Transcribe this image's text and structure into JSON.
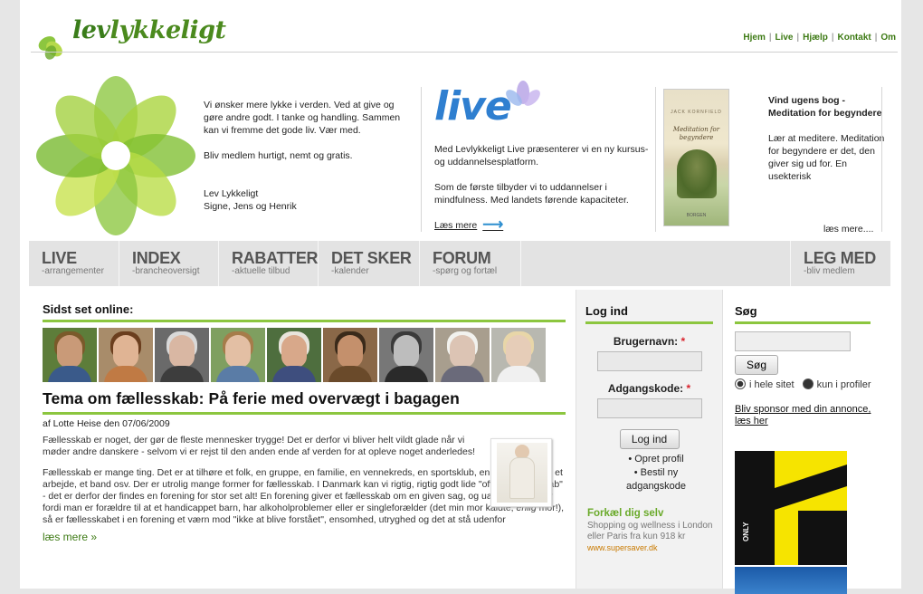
{
  "logo": {
    "lev": "lev",
    "rest": "lykkeligt"
  },
  "topnav": [
    "Hjem",
    "Live",
    "Hjælp",
    "Kontakt",
    "Om"
  ],
  "intro": {
    "p1": "Vi ønsker mere lykke i verden. Ved at give og gøre andre godt. I tanke og handling. Sammen kan vi fremme det gode liv. Vær med.",
    "p2": "Bliv medlem hurtigt, nemt og gratis.",
    "sig1": "Lev Lykkeligt",
    "sig2": "Signe, Jens og Henrik"
  },
  "live": {
    "logo": "live",
    "p1": "Med Levlykkeligt Live præsenterer vi en ny kursus- og uddannelsesplatform.",
    "p2": "Som de første tilbyder vi to uddannelser i mindfulness. Med landets førende kapaciteter.",
    "more": "Læs mere"
  },
  "book": {
    "cover_author": "JACK KORNFIELD",
    "cover_title": "Meditation for begyndere",
    "cover_pub": "BORGEN",
    "title": "Vind ugens bog - Meditation for begyndere",
    "text": "Lær at meditere. Meditation for begyndere er det, den giver sig ud for. En usekterisk",
    "more": "læs mere...."
  },
  "mainnav": [
    {
      "title": "LIVE",
      "sub": "-arrangementer"
    },
    {
      "title": "INDEX",
      "sub": "-brancheoversigt"
    },
    {
      "title": "RABATTER",
      "sub": "-aktuelle tilbud"
    },
    {
      "title": "DET SKER",
      "sub": "-kalender"
    },
    {
      "title": "FORUM",
      "sub": "-spørg og fortæl"
    },
    {
      "title": "LEG MED",
      "sub": "-bliv medlem"
    }
  ],
  "online": {
    "heading": "Sidst set online:",
    "faces": [
      {
        "skin": "#c99a78",
        "hair": "#7a5a2a",
        "bg": "#5d7d3a",
        "shirt": "#3a5a8a"
      },
      {
        "skin": "#e0b494",
        "hair": "#6b3e1e",
        "bg": "#a88c6a",
        "shirt": "#c07a44"
      },
      {
        "skin": "#d9b7a3",
        "hair": "#d9d9d9",
        "bg": "#6a6a6a",
        "shirt": "#3d3d3d"
      },
      {
        "skin": "#e3bfa4",
        "hair": "#a67c4a",
        "bg": "#7f9f60",
        "shirt": "#5a7ca6"
      },
      {
        "skin": "#d8a88a",
        "hair": "#e8e4dc",
        "bg": "#4e6e3e",
        "shirt": "#3e4e7e"
      },
      {
        "skin": "#c4906c",
        "hair": "#3a2a1a",
        "bg": "#8a6848",
        "shirt": "#6a4a2a"
      },
      {
        "skin": "#bdbdbd",
        "hair": "#3a3a3a",
        "bg": "#777777",
        "shirt": "#2a2a2a"
      },
      {
        "skin": "#dcc4b4",
        "hair": "#f2f2ee",
        "bg": "#a89e8e",
        "shirt": "#6a6a7a"
      },
      {
        "skin": "#e6cdb8",
        "hair": "#e8d6a8",
        "bg": "#b8b8b0",
        "shirt": "#f0f0f0"
      }
    ]
  },
  "article": {
    "title": "Tema om fællesskab: På ferie med overvægt i bagagen",
    "byline": "af Lotte Heise den 07/06/2009",
    "p1": "Fællesskab er noget, der gør de fleste mennesker trygge! Det er derfor vi bliver helt vildt glade når vi møder andre danskere - selvom vi er rejst til den anden ende af verden for at opleve noget anderledes!",
    "p2a": "Fællesskab er mange ting. Det er at tilhøre et folk, en gruppe, en familie, en vennekreds, en sportsklub, en mødregruppe, et arbejde, et band osv. Der er utrolig mange former for fællesskab. I Danmark kan vi rigtig, rigtig godt lide \"officielt fællesskab\" - det er derfor der findes en forening for stor set alt! En forening giver et fællesskab om en given sag, og uanset om det er fordi man er forældre til at et handicappet barn, har alkoholproblemer eller er singleforælder (det min mor kaldte, ",
    "p2em": "enlig",
    "p2b": " mor!), så er fællesskabet i en forening et værn mod \"ikke at blive forstået\", ensomhed, utryghed og det at stå udenfor",
    "more": "læs mere »"
  },
  "login": {
    "heading": "Log ind",
    "user_label": "Brugernavn:",
    "pass_label": "Adgangskode:",
    "required": "*",
    "button": "Log ind",
    "links": [
      "Opret profil",
      "Bestil ny adgangskode"
    ]
  },
  "promo": {
    "title": "Forkæl dig selv",
    "line1": "Shopping og wellness i London",
    "line2": "eller Paris fra kun 918 kr",
    "url": "www.supersaver.dk"
  },
  "search": {
    "heading": "Søg",
    "button": "Søg",
    "radio1": "i hele sitet",
    "radio2": "kun i profiler",
    "sponsor": "Bliv sponsor med din annonce, læs her",
    "ad_text": "ONLY"
  },
  "colors": {
    "green": "#8cc63f",
    "dark_green": "#3d7a14",
    "live_blue": "#2f7fd0"
  }
}
